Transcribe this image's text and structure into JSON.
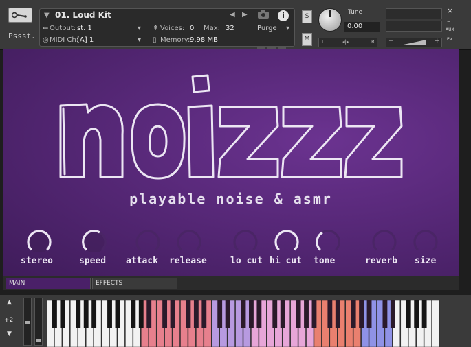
{
  "header": {
    "instrument_name": "01. Loud Kit",
    "logo_text": "Pssst.",
    "output_label": "Output:",
    "output_value": "st. 1",
    "voices_label": "Voices:",
    "voices_value": "0",
    "max_label": "Max:",
    "max_value": "32",
    "purge_label": "Purge",
    "midi_label": "MIDI Ch:",
    "midi_value": "[A]  1",
    "memory_label": "Memory:",
    "memory_value": "9.98 MB",
    "solo_label": "S",
    "mute_label": "M",
    "tune_label": "Tune",
    "tune_value": "0.00",
    "pan_left": "L",
    "pan_center": "◂|▸",
    "pan_right": "R",
    "vol_minus": "−",
    "vol_plus": "+",
    "close_label": "×",
    "minimize_label": "–",
    "aux_label": "AUX",
    "pv_label": "PV"
  },
  "main": {
    "logo_text": "noizzz",
    "tagline": "playable noise & asmr",
    "knobs": [
      {
        "name": "stereo",
        "label": "stereo",
        "value": 0.6
      },
      {
        "name": "speed",
        "label": "speed",
        "value": 0.5
      },
      {
        "name": "attack",
        "label": "attack",
        "value": 0.0
      },
      {
        "name": "release",
        "label": "release",
        "value": 0.0
      },
      {
        "name": "lo-cut",
        "label": "lo cut",
        "value": 0.0
      },
      {
        "name": "hi-cut",
        "label": "hi cut",
        "value": 1.0
      },
      {
        "name": "tone",
        "label": "tone",
        "value": 0.5
      },
      {
        "name": "reverb",
        "label": "reverb",
        "value": 0.0
      },
      {
        "name": "size",
        "label": "size",
        "value": 0.5
      }
    ]
  },
  "tabs": [
    {
      "label": "MAIN",
      "active": true
    },
    {
      "label": "EFFECTS",
      "active": false
    }
  ],
  "keyboard": {
    "octave_shift": "+2",
    "zone_colors": {
      "red": "#e7808d",
      "violet": "#b79ae0",
      "pink": "#e7a6d8",
      "salmon": "#e9806f",
      "blue": "#8f92e6"
    }
  }
}
